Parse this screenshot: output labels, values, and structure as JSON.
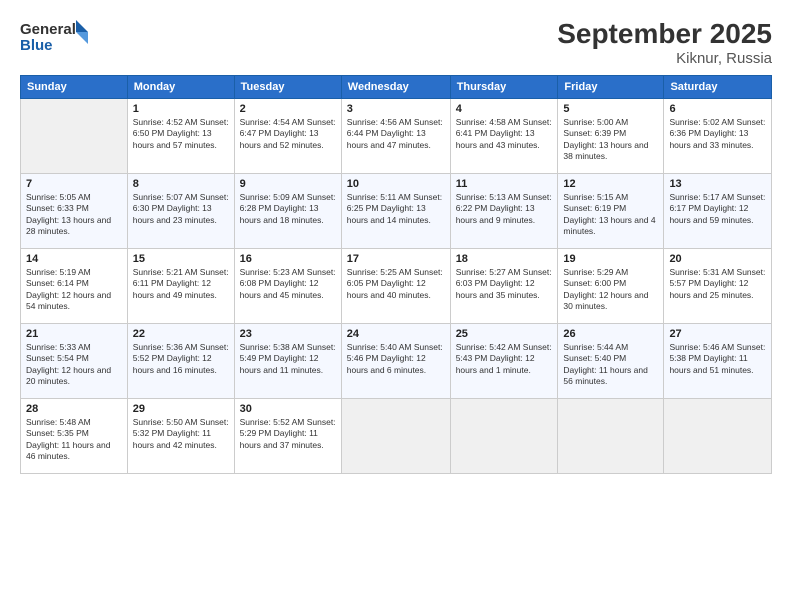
{
  "header": {
    "logo_line1": "General",
    "logo_line2": "Blue",
    "title": "September 2025",
    "subtitle": "Kiknur, Russia"
  },
  "days_of_week": [
    "Sunday",
    "Monday",
    "Tuesday",
    "Wednesday",
    "Thursday",
    "Friday",
    "Saturday"
  ],
  "weeks": [
    [
      {
        "day": "",
        "info": ""
      },
      {
        "day": "1",
        "info": "Sunrise: 4:52 AM\nSunset: 6:50 PM\nDaylight: 13 hours\nand 57 minutes."
      },
      {
        "day": "2",
        "info": "Sunrise: 4:54 AM\nSunset: 6:47 PM\nDaylight: 13 hours\nand 52 minutes."
      },
      {
        "day": "3",
        "info": "Sunrise: 4:56 AM\nSunset: 6:44 PM\nDaylight: 13 hours\nand 47 minutes."
      },
      {
        "day": "4",
        "info": "Sunrise: 4:58 AM\nSunset: 6:41 PM\nDaylight: 13 hours\nand 43 minutes."
      },
      {
        "day": "5",
        "info": "Sunrise: 5:00 AM\nSunset: 6:39 PM\nDaylight: 13 hours\nand 38 minutes."
      },
      {
        "day": "6",
        "info": "Sunrise: 5:02 AM\nSunset: 6:36 PM\nDaylight: 13 hours\nand 33 minutes."
      }
    ],
    [
      {
        "day": "7",
        "info": "Sunrise: 5:05 AM\nSunset: 6:33 PM\nDaylight: 13 hours\nand 28 minutes."
      },
      {
        "day": "8",
        "info": "Sunrise: 5:07 AM\nSunset: 6:30 PM\nDaylight: 13 hours\nand 23 minutes."
      },
      {
        "day": "9",
        "info": "Sunrise: 5:09 AM\nSunset: 6:28 PM\nDaylight: 13 hours\nand 18 minutes."
      },
      {
        "day": "10",
        "info": "Sunrise: 5:11 AM\nSunset: 6:25 PM\nDaylight: 13 hours\nand 14 minutes."
      },
      {
        "day": "11",
        "info": "Sunrise: 5:13 AM\nSunset: 6:22 PM\nDaylight: 13 hours\nand 9 minutes."
      },
      {
        "day": "12",
        "info": "Sunrise: 5:15 AM\nSunset: 6:19 PM\nDaylight: 13 hours\nand 4 minutes."
      },
      {
        "day": "13",
        "info": "Sunrise: 5:17 AM\nSunset: 6:17 PM\nDaylight: 12 hours\nand 59 minutes."
      }
    ],
    [
      {
        "day": "14",
        "info": "Sunrise: 5:19 AM\nSunset: 6:14 PM\nDaylight: 12 hours\nand 54 minutes."
      },
      {
        "day": "15",
        "info": "Sunrise: 5:21 AM\nSunset: 6:11 PM\nDaylight: 12 hours\nand 49 minutes."
      },
      {
        "day": "16",
        "info": "Sunrise: 5:23 AM\nSunset: 6:08 PM\nDaylight: 12 hours\nand 45 minutes."
      },
      {
        "day": "17",
        "info": "Sunrise: 5:25 AM\nSunset: 6:05 PM\nDaylight: 12 hours\nand 40 minutes."
      },
      {
        "day": "18",
        "info": "Sunrise: 5:27 AM\nSunset: 6:03 PM\nDaylight: 12 hours\nand 35 minutes."
      },
      {
        "day": "19",
        "info": "Sunrise: 5:29 AM\nSunset: 6:00 PM\nDaylight: 12 hours\nand 30 minutes."
      },
      {
        "day": "20",
        "info": "Sunrise: 5:31 AM\nSunset: 5:57 PM\nDaylight: 12 hours\nand 25 minutes."
      }
    ],
    [
      {
        "day": "21",
        "info": "Sunrise: 5:33 AM\nSunset: 5:54 PM\nDaylight: 12 hours\nand 20 minutes."
      },
      {
        "day": "22",
        "info": "Sunrise: 5:36 AM\nSunset: 5:52 PM\nDaylight: 12 hours\nand 16 minutes."
      },
      {
        "day": "23",
        "info": "Sunrise: 5:38 AM\nSunset: 5:49 PM\nDaylight: 12 hours\nand 11 minutes."
      },
      {
        "day": "24",
        "info": "Sunrise: 5:40 AM\nSunset: 5:46 PM\nDaylight: 12 hours\nand 6 minutes."
      },
      {
        "day": "25",
        "info": "Sunrise: 5:42 AM\nSunset: 5:43 PM\nDaylight: 12 hours\nand 1 minute."
      },
      {
        "day": "26",
        "info": "Sunrise: 5:44 AM\nSunset: 5:40 PM\nDaylight: 11 hours\nand 56 minutes."
      },
      {
        "day": "27",
        "info": "Sunrise: 5:46 AM\nSunset: 5:38 PM\nDaylight: 11 hours\nand 51 minutes."
      }
    ],
    [
      {
        "day": "28",
        "info": "Sunrise: 5:48 AM\nSunset: 5:35 PM\nDaylight: 11 hours\nand 46 minutes."
      },
      {
        "day": "29",
        "info": "Sunrise: 5:50 AM\nSunset: 5:32 PM\nDaylight: 11 hours\nand 42 minutes."
      },
      {
        "day": "30",
        "info": "Sunrise: 5:52 AM\nSunset: 5:29 PM\nDaylight: 11 hours\nand 37 minutes."
      },
      {
        "day": "",
        "info": ""
      },
      {
        "day": "",
        "info": ""
      },
      {
        "day": "",
        "info": ""
      },
      {
        "day": "",
        "info": ""
      }
    ]
  ]
}
